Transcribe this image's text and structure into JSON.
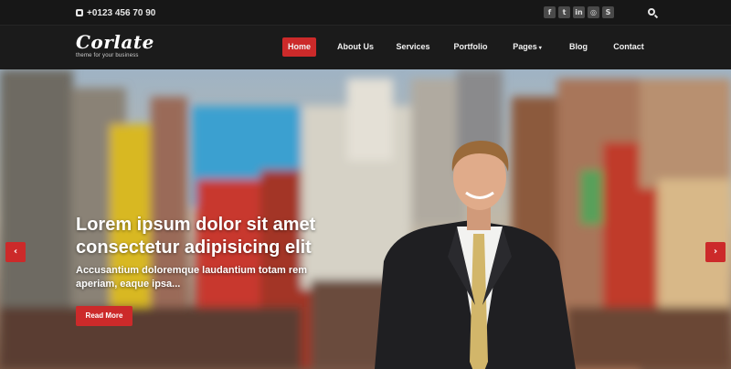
{
  "topbar": {
    "phone": "+0123 456 70 90",
    "social": [
      {
        "icon": "facebook-icon",
        "glyph": "f"
      },
      {
        "icon": "twitter-icon",
        "glyph": "t"
      },
      {
        "icon": "linkedin-icon",
        "glyph": "in"
      },
      {
        "icon": "dribbble-icon",
        "glyph": "◎"
      },
      {
        "icon": "skype-icon",
        "glyph": "S"
      }
    ],
    "search_icon": "search-icon"
  },
  "brand": {
    "logo": "Corlate",
    "tagline": "theme for your business"
  },
  "nav": {
    "items": [
      {
        "label": "Home",
        "active": true
      },
      {
        "label": "About Us",
        "active": false
      },
      {
        "label": "Services",
        "active": false
      },
      {
        "label": "Portfolio",
        "active": false
      },
      {
        "label": "Pages",
        "active": false,
        "dropdown": true
      },
      {
        "label": "Blog",
        "active": false
      },
      {
        "label": "Contact",
        "active": false
      }
    ]
  },
  "hero": {
    "title": "Lorem ipsum dolor sit amet consectetur adipisicing elit",
    "subtitle": "Accusantium doloremque laudantium totam rem aperiam, eaque ipsa...",
    "button": "Read More",
    "prev_icon": "chevron-left-icon",
    "next_icon": "chevron-right-icon"
  },
  "colors": {
    "accent": "#cc2a2a",
    "topbar_bg": "#171717",
    "nav_bg": "#1b1b1b"
  }
}
